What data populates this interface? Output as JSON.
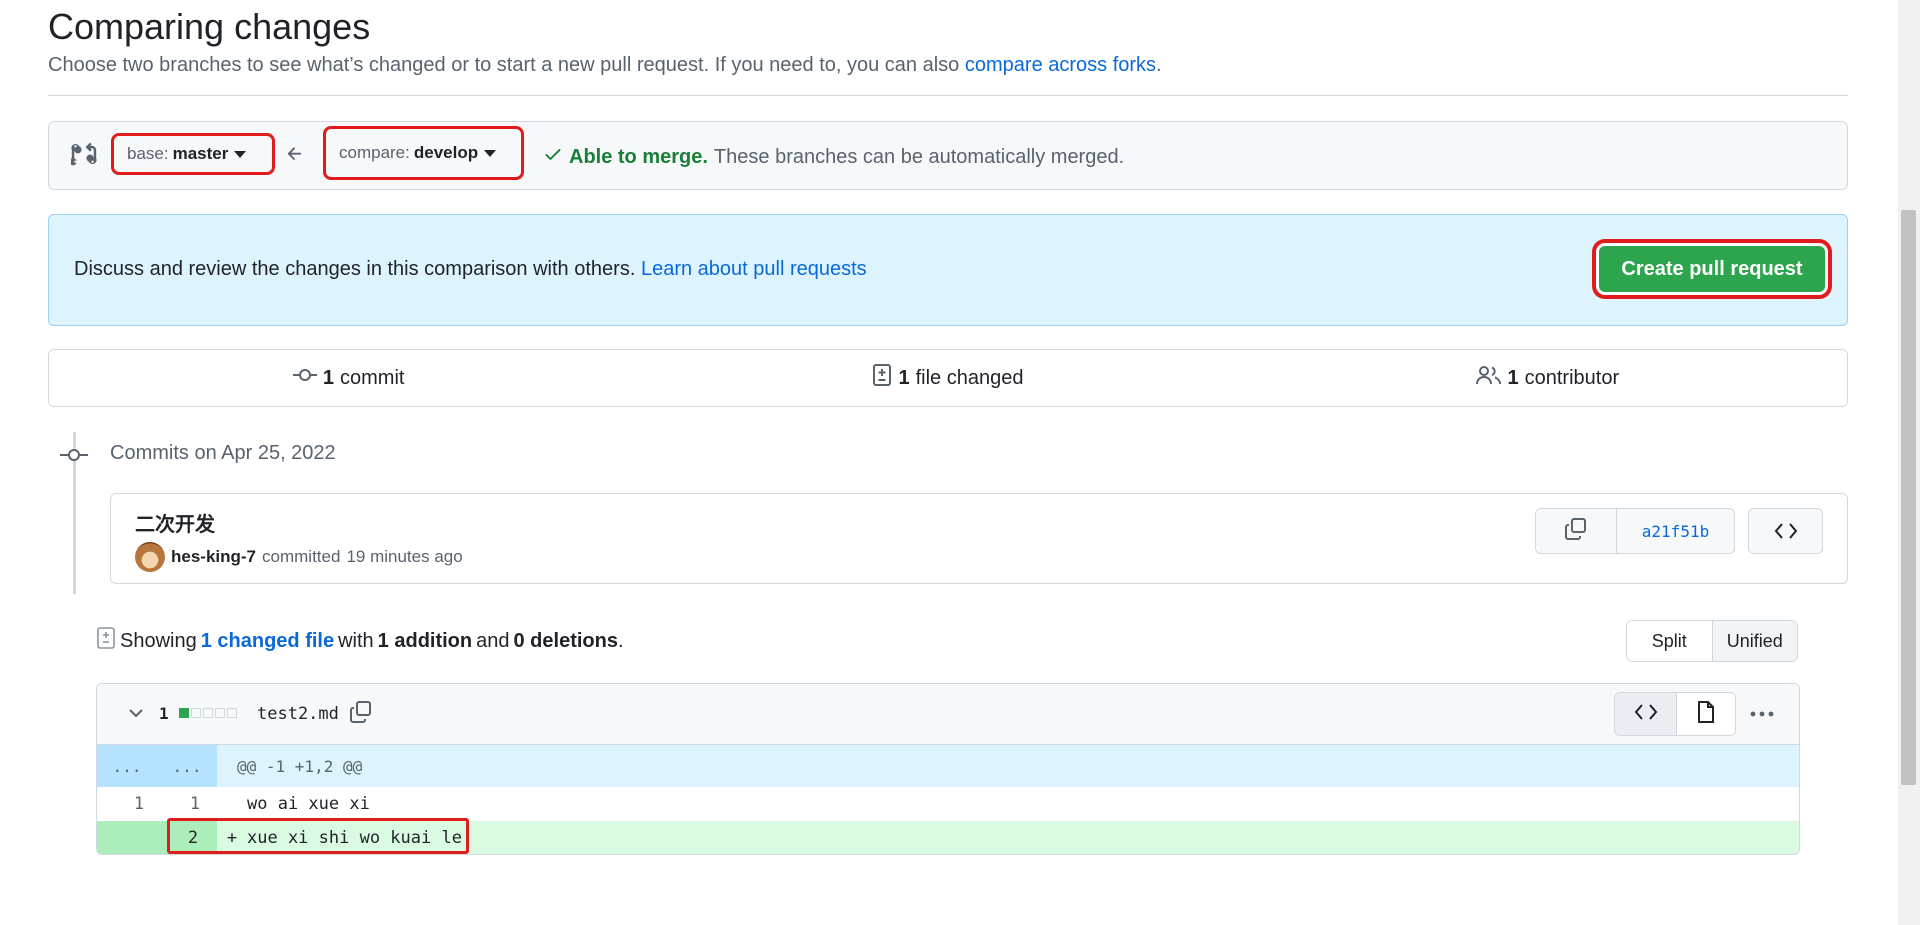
{
  "page": {
    "title": "Comparing changes",
    "subtitle_prefix": "Choose two branches to see what’s changed or to start a new pull request. If you need to, you can also",
    "subtitle_link": "compare across forks",
    "subtitle_suffix": "."
  },
  "range": {
    "base_label": "base:",
    "base_value": "master",
    "compare_label": "compare:",
    "compare_value": "develop",
    "merge_status": "Able to merge.",
    "merge_desc": "These branches can be automatically merged."
  },
  "discuss": {
    "text": "Discuss and review the changes in this comparison with others.",
    "link": "Learn about pull requests",
    "button": "Create pull request"
  },
  "stats": {
    "commits_count": "1",
    "commits_label": "commit",
    "files_count": "1",
    "files_label": "file changed",
    "contributors_count": "1",
    "contributors_label": "contributor"
  },
  "commits": {
    "date_label": "Commits on Apr 25, 2022",
    "items": [
      {
        "title": "二次开发",
        "author": "hes-king-7",
        "action": "committed",
        "time": "19 minutes ago",
        "sha": "a21f51b"
      }
    ]
  },
  "summary": {
    "showing": "Showing",
    "changed_files_link": "1 changed file",
    "with": "with",
    "additions": "1 addition",
    "and": "and",
    "deletions": "0 deletions",
    "period": ".",
    "split_label": "Split",
    "unified_label": "Unified",
    "active_view": "Unified"
  },
  "file": {
    "changes": "1",
    "name": "test2.md",
    "diffstat": {
      "additions": 1,
      "total_blocks": 5
    },
    "hunk": {
      "left": "...",
      "right": "...",
      "header": "@@ -1 +1,2 @@"
    },
    "lines": [
      {
        "old": "1",
        "new": "1",
        "marker": "",
        "code": "wo ai xue xi",
        "type": "context"
      },
      {
        "old": "",
        "new": "2",
        "marker": "+",
        "code": "xue xi shi wo kuai le",
        "type": "addition"
      }
    ]
  },
  "colors": {
    "accent": "#0969da",
    "success": "#1a7f37",
    "button_green": "#2da44e",
    "highlight_red": "#e01b1b",
    "addition_bg": "#dafbe1",
    "hunk_bg": "#ddf4ff"
  }
}
